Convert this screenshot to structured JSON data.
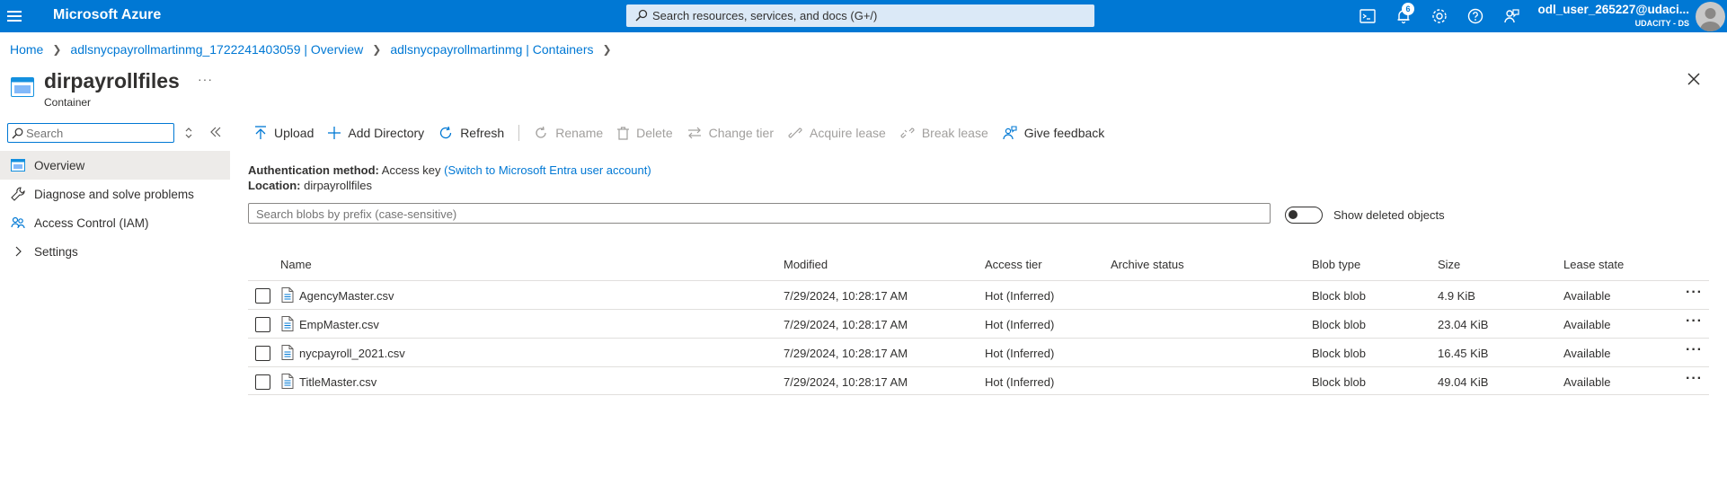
{
  "app": {
    "brand": "Microsoft Azure"
  },
  "search": {
    "placeholder": "Search resources, services, and docs (G+/)"
  },
  "notifications": {
    "count": "6"
  },
  "user": {
    "name": "odl_user_265227@udaci...",
    "org": "UDACITY - DS"
  },
  "breadcrumb": [
    {
      "label": "Home"
    },
    {
      "label": "adlsnycpayrollmartinmg_1722241403059 | Overview"
    },
    {
      "label": "adlsnycpayrollmartinmg | Containers"
    }
  ],
  "page": {
    "title": "dirpayrollfiles",
    "subtitle": "Container"
  },
  "nav": {
    "search_placeholder": "Search",
    "items": [
      {
        "label": "Overview"
      },
      {
        "label": "Diagnose and solve problems"
      },
      {
        "label": "Access Control (IAM)"
      },
      {
        "label": "Settings"
      }
    ]
  },
  "toolbar": {
    "upload": "Upload",
    "add_directory": "Add Directory",
    "refresh": "Refresh",
    "rename": "Rename",
    "delete": "Delete",
    "change_tier": "Change tier",
    "acquire_lease": "Acquire lease",
    "break_lease": "Break lease",
    "give_feedback": "Give feedback"
  },
  "info": {
    "auth_label": "Authentication method:",
    "auth_value": "Access key",
    "auth_link": "(Switch to Microsoft Entra user account)",
    "location_label": "Location:",
    "location_value": "dirpayrollfiles"
  },
  "blob_search": {
    "placeholder": "Search blobs by prefix (case-sensitive)"
  },
  "show_deleted": {
    "label": "Show deleted objects",
    "on": false
  },
  "table": {
    "headers": {
      "name": "Name",
      "modified": "Modified",
      "access_tier": "Access tier",
      "archive_status": "Archive status",
      "blob_type": "Blob type",
      "size": "Size",
      "lease_state": "Lease state"
    },
    "rows": [
      {
        "name": "AgencyMaster.csv",
        "modified": "7/29/2024, 10:28:17 AM",
        "access_tier": "Hot (Inferred)",
        "archive_status": "",
        "blob_type": "Block blob",
        "size": "4.9 KiB",
        "lease_state": "Available"
      },
      {
        "name": "EmpMaster.csv",
        "modified": "7/29/2024, 10:28:17 AM",
        "access_tier": "Hot (Inferred)",
        "archive_status": "",
        "blob_type": "Block blob",
        "size": "23.04 KiB",
        "lease_state": "Available"
      },
      {
        "name": "nycpayroll_2021.csv",
        "modified": "7/29/2024, 10:28:17 AM",
        "access_tier": "Hot (Inferred)",
        "archive_status": "",
        "blob_type": "Block blob",
        "size": "16.45 KiB",
        "lease_state": "Available"
      },
      {
        "name": "TitleMaster.csv",
        "modified": "7/29/2024, 10:28:17 AM",
        "access_tier": "Hot (Inferred)",
        "archive_status": "",
        "blob_type": "Block blob",
        "size": "49.04 KiB",
        "lease_state": "Available"
      }
    ]
  },
  "colors": {
    "accent": "#0078d4",
    "nav_active": "#edebe9",
    "disabled": "#a19f9d"
  }
}
